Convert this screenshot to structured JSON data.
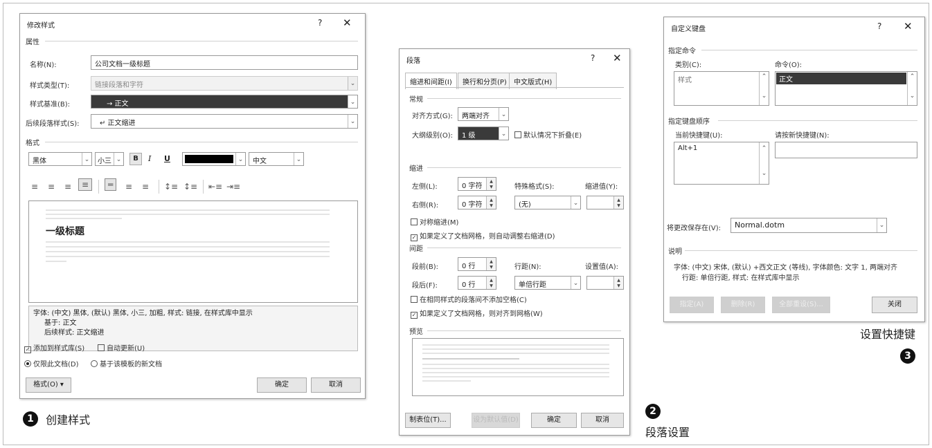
{
  "colors": {
    "accent_selection": "#3a3a3a",
    "dialog_border": "#999999",
    "font_color_swatch": "#000000"
  },
  "dialog1": {
    "title": "修改样式",
    "help": "?",
    "close": "✕",
    "props_section": "属性",
    "name_label": "名称(N):",
    "name_value": "公司文档一级标题",
    "type_label": "样式类型(T):",
    "type_value": "链接段落和字符",
    "base_label": "样式基准(B):",
    "base_value": "→ 正文",
    "next_label": "后续段落样式(S):",
    "next_value": "↵ 正文缩进",
    "format_section": "格式",
    "font_value": "黑体",
    "size_value": "小三",
    "bold": "B",
    "italic": "I",
    "underline": "U",
    "script_value": "中文",
    "preview_heading": "一级标题",
    "desc_line1": "字体: (中文) 黑体, (默认) 黑体, 小三, 加粗, 样式: 链接, 在样式库中显示",
    "desc_line2": "基于: 正文",
    "desc_line3": "后续样式: 正文缩进",
    "add_gallery": "添加到样式库(S)",
    "auto_update": "自动更新(U)",
    "only_doc": "仅限此文档(D)",
    "new_docs": "基于该模板的新文档",
    "format_btn": "格式(O) ▾",
    "ok": "确定",
    "cancel": "取消"
  },
  "dialog2": {
    "title": "段落",
    "help": "?",
    "close": "✕",
    "tabs": [
      "缩进和间距(I)",
      "换行和分页(P)",
      "中文版式(H)"
    ],
    "general_section": "常规",
    "align_label": "对齐方式(G):",
    "align_value": "两端对齐",
    "outline_label": "大纲级别(O):",
    "outline_value": "1 级",
    "collapse_label": "默认情况下折叠(E)",
    "indent_section": "缩进",
    "left_label": "左侧(L):",
    "left_value": "0 字符",
    "right_label": "右侧(R):",
    "right_value": "0 字符",
    "special_label": "特殊格式(S):",
    "special_value": "(无)",
    "indent_by_label": "缩进值(Y):",
    "mirror_label": "对称缩进(M)",
    "grid_indent_label": "如果定义了文档网格，则自动调整右缩进(D)",
    "spacing_section": "间距",
    "before_label": "段前(B):",
    "before_value": "0 行",
    "after_label": "段后(F):",
    "after_value": "0 行",
    "linespacing_label": "行距(N):",
    "linespacing_value": "单倍行距",
    "at_label": "设置值(A):",
    "nospace_label": "在相同样式的段落间不添加空格(C)",
    "snap_label": "如果定义了文档网格，则对齐到网格(W)",
    "preview_section": "预览",
    "tabs_btn": "制表位(T)...",
    "default_btn": "设为默认值(D)",
    "ok": "确定",
    "cancel": "取消"
  },
  "dialog3": {
    "title": "自定义键盘",
    "help": "?",
    "close": "✕",
    "assign_section": "指定命令",
    "category_label": "类别(C):",
    "category_item": "样式",
    "command_label": "命令(O):",
    "command_item": "正文",
    "keyseq_section": "指定键盘顺序",
    "current_keys_label": "当前快捷键(U):",
    "current_key": "Alt+1",
    "new_key_label": "请按新快捷键(N):",
    "save_label": "将更改保存在(V):",
    "save_value": "Normal.dotm",
    "desc_section": "说明",
    "desc_line1": "字体: (中文) 宋体, (默认) +西文正文 (等线), 字体颜色: 文字 1, 两端对齐",
    "desc_line2": "行距: 单倍行距, 样式: 在样式库中显示",
    "assign_btn": "指定(A)",
    "remove_btn": "删除(R)",
    "reset_btn": "全部重设(S)...",
    "close_btn": "关闭"
  },
  "captions": {
    "step1_num": "1",
    "step1_text": "创建样式",
    "step2_num": "2",
    "step2_text": "段落设置",
    "step3_num": "3",
    "step3_text": "设置快捷键"
  }
}
